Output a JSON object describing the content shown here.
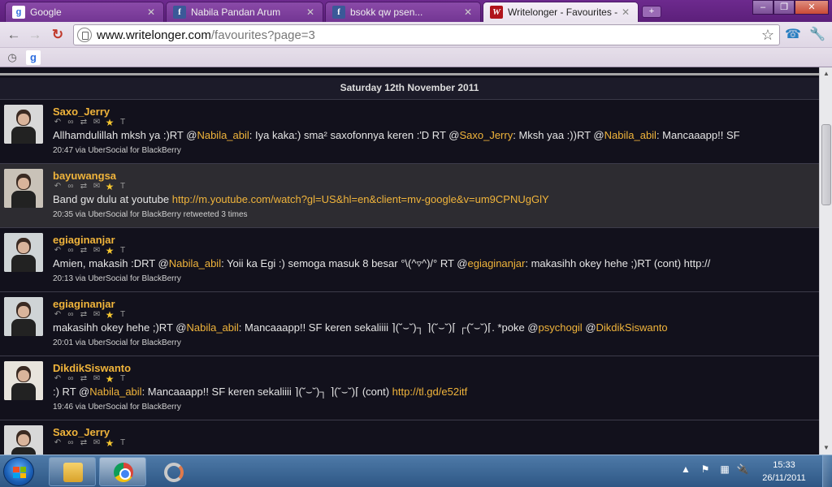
{
  "browser": {
    "tabs": [
      {
        "title": "Google",
        "favicon": "google-icon",
        "active": false
      },
      {
        "title": "Nabila Pandan Arum",
        "favicon": "facebook-icon",
        "active": false
      },
      {
        "title": "bsokk qw psen...",
        "favicon": "facebook-icon",
        "active": false
      },
      {
        "title": "Writelonger - Favourites - @",
        "favicon": "writelonger-icon",
        "active": true
      }
    ],
    "url_domain": "www.writelonger.com",
    "url_path": "/favourites?page=3"
  },
  "page": {
    "date_header": "Saturday 12th November 2011",
    "tweets": [
      {
        "user": "Saxo_Jerry",
        "segments": [
          {
            "t": "Allhamdulillah mksh ya :)RT ",
            "k": "text"
          },
          {
            "t": "@",
            "k": "text"
          },
          {
            "t": "Nabila_abil",
            "k": "mention"
          },
          {
            "t": ": Iya kaka:) sma² saxofonnya keren :'D RT @",
            "k": "text"
          },
          {
            "t": "Saxo_Jerry",
            "k": "mention"
          },
          {
            "t": ": Mksh yaa :))RT @",
            "k": "text"
          },
          {
            "t": "Nabila_abil",
            "k": "mention"
          },
          {
            "t": ": Mancaaapp!! SF",
            "k": "text"
          }
        ],
        "meta": "20:47 via UberSocial for BlackBerry",
        "highlight": false
      },
      {
        "user": "bayuwangsa",
        "segments": [
          {
            "t": "Band gw dulu at youtube ",
            "k": "text"
          },
          {
            "t": "http://m.youtube.com/watch?gl=US&hl=en&client=mv-google&v=um9CPNUgGlY",
            "k": "link"
          }
        ],
        "meta": "20:35 via UberSocial for BlackBerry retweeted 3 times",
        "highlight": true
      },
      {
        "user": "egiaginanjar",
        "segments": [
          {
            "t": "Amien, makasih :DRT @",
            "k": "text"
          },
          {
            "t": "Nabila_abil",
            "k": "mention"
          },
          {
            "t": ": Yoii ka Egi :) semoga masuk 8 besar °\\(^▿^)/° RT @",
            "k": "text"
          },
          {
            "t": "egiaginanjar",
            "k": "mention"
          },
          {
            "t": ": makasihh okey hehe ;)RT (cont) http://",
            "k": "text"
          }
        ],
        "meta": "20:13 via UberSocial for BlackBerry",
        "highlight": false
      },
      {
        "user": "egiaginanjar",
        "segments": [
          {
            "t": "makasihh okey hehe ;)RT @",
            "k": "text"
          },
          {
            "t": "Nabila_abil",
            "k": "mention"
          },
          {
            "t": ": Mancaaapp!! SF keren sekaliiii ⌉(˘⌣˘)┐ ⌉(˘⌣˘)⌈ ┌(˘⌣˘)⌈. *poke @",
            "k": "text"
          },
          {
            "t": "psychogil",
            "k": "mention"
          },
          {
            "t": " @",
            "k": "text"
          },
          {
            "t": "DikdikSiswanto",
            "k": "mention"
          }
        ],
        "meta": "20:01 via UberSocial for BlackBerry",
        "highlight": false
      },
      {
        "user": "DikdikSiswanto",
        "segments": [
          {
            "t": ":) RT @",
            "k": "text"
          },
          {
            "t": "Nabila_abil",
            "k": "mention"
          },
          {
            "t": ": Mancaaapp!! SF keren sekaliiii ⌉(˘⌣˘)┐ ⌉(˘⌣˘)⌈ (cont) ",
            "k": "text"
          },
          {
            "t": "http://tl.gd/e52itf",
            "k": "link"
          }
        ],
        "meta": "19:46 via UberSocial for BlackBerry",
        "highlight": false
      },
      {
        "user": "Saxo_Jerry",
        "segments": [],
        "meta": "",
        "highlight": false
      }
    ]
  },
  "taskbar": {
    "time": "15:33",
    "date": "26/11/2011"
  },
  "colors": {
    "accent": "#f0b43b",
    "content_bg": "#12111c",
    "chrome_frame": "#6d2a8e"
  }
}
